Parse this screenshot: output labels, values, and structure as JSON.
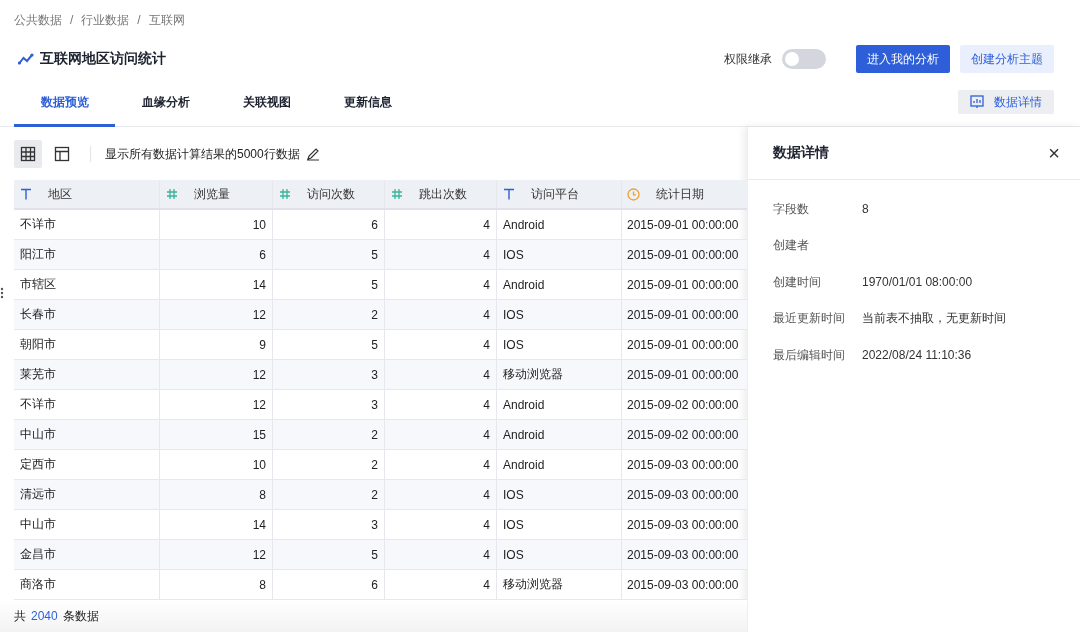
{
  "breadcrumb": [
    "公共数据",
    "行业数据",
    "互联网"
  ],
  "breadcrumb_separator": "/",
  "title": "互联网地区访问统计",
  "permission_inherit": {
    "label": "权限继承",
    "on": false
  },
  "buttons": [
    {
      "label": "进入我的分析",
      "kind": "primary"
    },
    {
      "label": "创建分析主题",
      "kind": "secondary"
    }
  ],
  "tabs": [
    {
      "label": "数据预览",
      "selected": true
    },
    {
      "label": "血缘分析",
      "selected": false
    },
    {
      "label": "关联视图",
      "selected": false
    },
    {
      "label": "更新信息",
      "selected": false
    }
  ],
  "detail_button": "数据详情",
  "view_modes": [
    {
      "kind": "grid",
      "selected": true
    },
    {
      "kind": "layout",
      "selected": false
    }
  ],
  "toolbar_text": "显示所有数据计算结果的5000行数据",
  "table": {
    "columns": [
      {
        "label": "地区",
        "kind": "text"
      },
      {
        "label": "浏览量",
        "kind": "number"
      },
      {
        "label": "访问次数",
        "kind": "number"
      },
      {
        "label": "跳出次数",
        "kind": "number"
      },
      {
        "label": "访问平台",
        "kind": "text"
      },
      {
        "label": "统计日期",
        "kind": "date"
      }
    ],
    "rows": [
      [
        "不详市",
        "10",
        "6",
        "4",
        "Android",
        "2015-09-01 00:00:00"
      ],
      [
        "阳江市",
        "6",
        "5",
        "4",
        "IOS",
        "2015-09-01 00:00:00"
      ],
      [
        "市辖区",
        "14",
        "5",
        "4",
        "Android",
        "2015-09-01 00:00:00"
      ],
      [
        "长春市",
        "12",
        "2",
        "4",
        "IOS",
        "2015-09-01 00:00:00"
      ],
      [
        "朝阳市",
        "9",
        "5",
        "4",
        "IOS",
        "2015-09-01 00:00:00"
      ],
      [
        "莱芜市",
        "12",
        "3",
        "4",
        "移动浏览器",
        "2015-09-01 00:00:00"
      ],
      [
        "不详市",
        "12",
        "3",
        "4",
        "Android",
        "2015-09-02 00:00:00"
      ],
      [
        "中山市",
        "15",
        "2",
        "4",
        "Android",
        "2015-09-02 00:00:00"
      ],
      [
        "定西市",
        "10",
        "2",
        "4",
        "Android",
        "2015-09-03 00:00:00"
      ],
      [
        "清远市",
        "8",
        "2",
        "4",
        "IOS",
        "2015-09-03 00:00:00"
      ],
      [
        "中山市",
        "14",
        "3",
        "4",
        "IOS",
        "2015-09-03 00:00:00"
      ],
      [
        "金昌市",
        "12",
        "5",
        "4",
        "IOS",
        "2015-09-03 00:00:00"
      ],
      [
        "商洛市",
        "8",
        "6",
        "4",
        "移动浏览器",
        "2015-09-03 00:00:00"
      ]
    ]
  },
  "footer": {
    "prefix": "共",
    "count": "2040",
    "suffix": "条数据"
  },
  "detail_panel": {
    "title": "数据详情",
    "close": "×",
    "fields": [
      {
        "label": "字段数",
        "value": "8"
      },
      {
        "label": "创建者"
      },
      {
        "label": "创建时间",
        "value": "1970/01/01 08:00:00"
      },
      {
        "label": "最近更新时间",
        "value": "当前表不抽取，无更新时间"
      },
      {
        "label": "最后编辑时间",
        "value": "2022/08/24 11:10:36"
      }
    ]
  }
}
